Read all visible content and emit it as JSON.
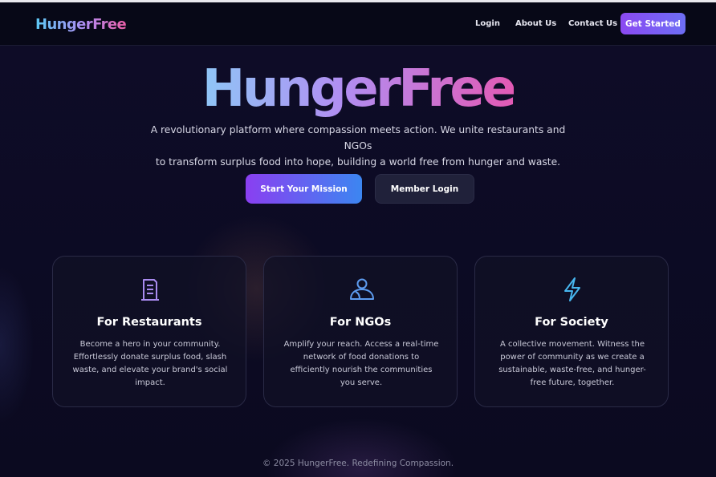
{
  "header": {
    "logo": "HungerFree",
    "nav": [
      {
        "label": "Login"
      },
      {
        "label": "About Us"
      },
      {
        "label": "Contact Us"
      }
    ],
    "cta_label": "Get Started"
  },
  "hero": {
    "title": "HungerFree",
    "subtitle_line1": "A revolutionary platform where compassion meets action. We unite restaurants and NGOs",
    "subtitle_line2": "to transform surplus food into hope, building a world free from hunger and waste.",
    "primary_button": "Start Your Mission",
    "secondary_button": "Member Login"
  },
  "cards": [
    {
      "icon": "receipt-icon",
      "title": "For Restaurants",
      "text": "Become a hero in your community. Effortlessly donate surplus food, slash waste, and elevate your brand's social impact."
    },
    {
      "icon": "user-icon",
      "title": "For NGOs",
      "text": "Amplify your reach. Access a real-time network of food donations to efficiently nourish the communities you serve."
    },
    {
      "icon": "lightning-icon",
      "title": "For Society",
      "text": "A collective movement. Witness the power of community as we create a sustainable, waste-free, and hunger-free future, together."
    }
  ],
  "footer": {
    "text": "© 2025 HungerFree. Redefining Compassion."
  },
  "colors": {
    "background": "#0b0a20",
    "header": "#070817",
    "accent_purple": "#8b49f2",
    "accent_blue": "#3c86f1",
    "accent_pink": "#e25ab4",
    "icon_purple": "#a98bf0",
    "icon_blue": "#5d9cf0",
    "icon_cyan": "#47b6ee"
  }
}
